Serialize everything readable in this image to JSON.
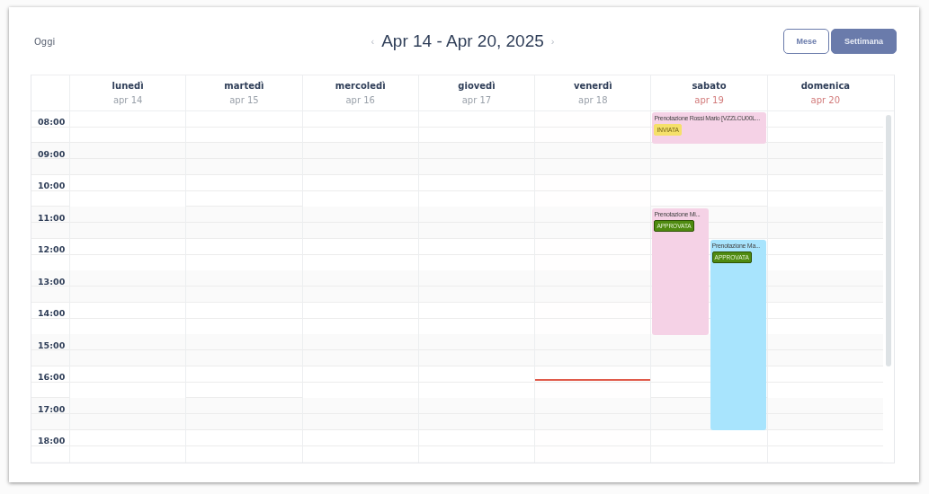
{
  "toolbar": {
    "today_button": "Oggi",
    "prev": "‹",
    "title": "Apr 14 - Apr 20, 2025",
    "next": "›",
    "views": [
      {
        "label": "Mese",
        "selected": false
      },
      {
        "label": "Settimana",
        "selected": true
      }
    ]
  },
  "hours": [
    "08:00",
    "09:00",
    "10:00",
    "11:00",
    "12:00",
    "13:00",
    "14:00",
    "15:00",
    "16:00",
    "17:00",
    "18:00"
  ],
  "days": [
    {
      "name": "lunedì",
      "date": "apr 14",
      "weekend": false,
      "today": false
    },
    {
      "name": "martedì",
      "date": "apr 15",
      "weekend": false,
      "today": false
    },
    {
      "name": "mercoledì",
      "date": "apr 16",
      "weekend": false,
      "today": false
    },
    {
      "name": "giovedì",
      "date": "apr 17",
      "weekend": false,
      "today": false
    },
    {
      "name": "venerdì",
      "date": "apr 18",
      "weekend": false,
      "today": true
    },
    {
      "name": "sabato",
      "date": "apr 19",
      "weekend": true,
      "today": false,
      "events": [
        {
          "title": "Prenotazione Rossi Mario [VZZLCU00L...",
          "color": "#f5d2e6",
          "status": {
            "label": "INVIATA",
            "kind": "pending"
          }
        },
        {
          "title": "Prenotazione Mi...",
          "color": "#f5d2e6",
          "status": {
            "label": "APPROVATA",
            "kind": "approved"
          }
        },
        {
          "title": "Prenotazione Ma...",
          "color": "#a8e4fd",
          "status": {
            "label": "APPROVATA",
            "kind": "approved"
          }
        }
      ]
    },
    {
      "name": "domenica",
      "date": "apr 20",
      "weekend": true,
      "today": false
    }
  ]
}
